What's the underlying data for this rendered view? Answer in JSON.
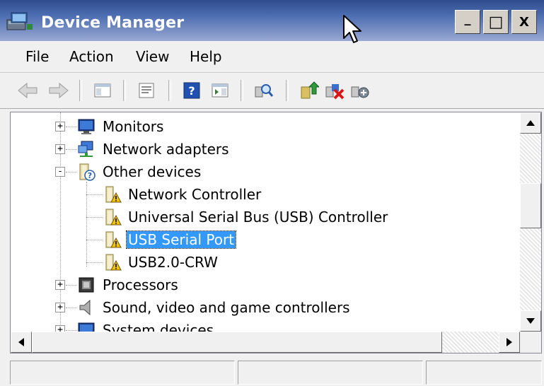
{
  "window": {
    "title": "Device Manager",
    "controls": {
      "minimize": "_",
      "maximize": "□",
      "close": "X"
    }
  },
  "menu": [
    "File",
    "Action",
    "View",
    "Help"
  ],
  "toolbar": {
    "buttons": [
      "back-icon",
      "forward-icon",
      "show-hide-console-tree-icon",
      "properties-icon",
      "help-icon",
      "action-pane-icon",
      "scan-hardware-icon",
      "update-driver-icon",
      "uninstall-icon",
      "disable-icon"
    ]
  },
  "tree": {
    "nodes": [
      {
        "label": "Monitors",
        "icon": "monitor-icon",
        "level": 1,
        "expander": "+"
      },
      {
        "label": "Network adapters",
        "icon": "network-adapter-icon",
        "level": 1,
        "expander": "+"
      },
      {
        "label": "Other devices",
        "icon": "unknown-device-icon",
        "level": 1,
        "expander": "-"
      },
      {
        "label": "Network Controller",
        "icon": "warning-device-icon",
        "level": 2
      },
      {
        "label": "Universal Serial Bus (USB) Controller",
        "icon": "warning-device-icon",
        "level": 2
      },
      {
        "label": "USB Serial Port",
        "icon": "warning-device-icon",
        "level": 2,
        "selected": true
      },
      {
        "label": "USB2.0-CRW",
        "icon": "warning-device-icon",
        "level": 2
      },
      {
        "label": "Processors",
        "icon": "processor-icon",
        "level": 1,
        "expander": "+"
      },
      {
        "label": "Sound, video and game controllers",
        "icon": "speaker-icon",
        "level": 1,
        "expander": "+"
      },
      {
        "label": "System devices",
        "icon": "system-device-icon",
        "level": 1,
        "expander": "+"
      }
    ]
  },
  "statusbar": {
    "panels": [
      "",
      "",
      ""
    ]
  },
  "colors": {
    "title_gradient_start": "#2f4c8c",
    "selection": "#3399ff",
    "warning": "#f5c400"
  }
}
